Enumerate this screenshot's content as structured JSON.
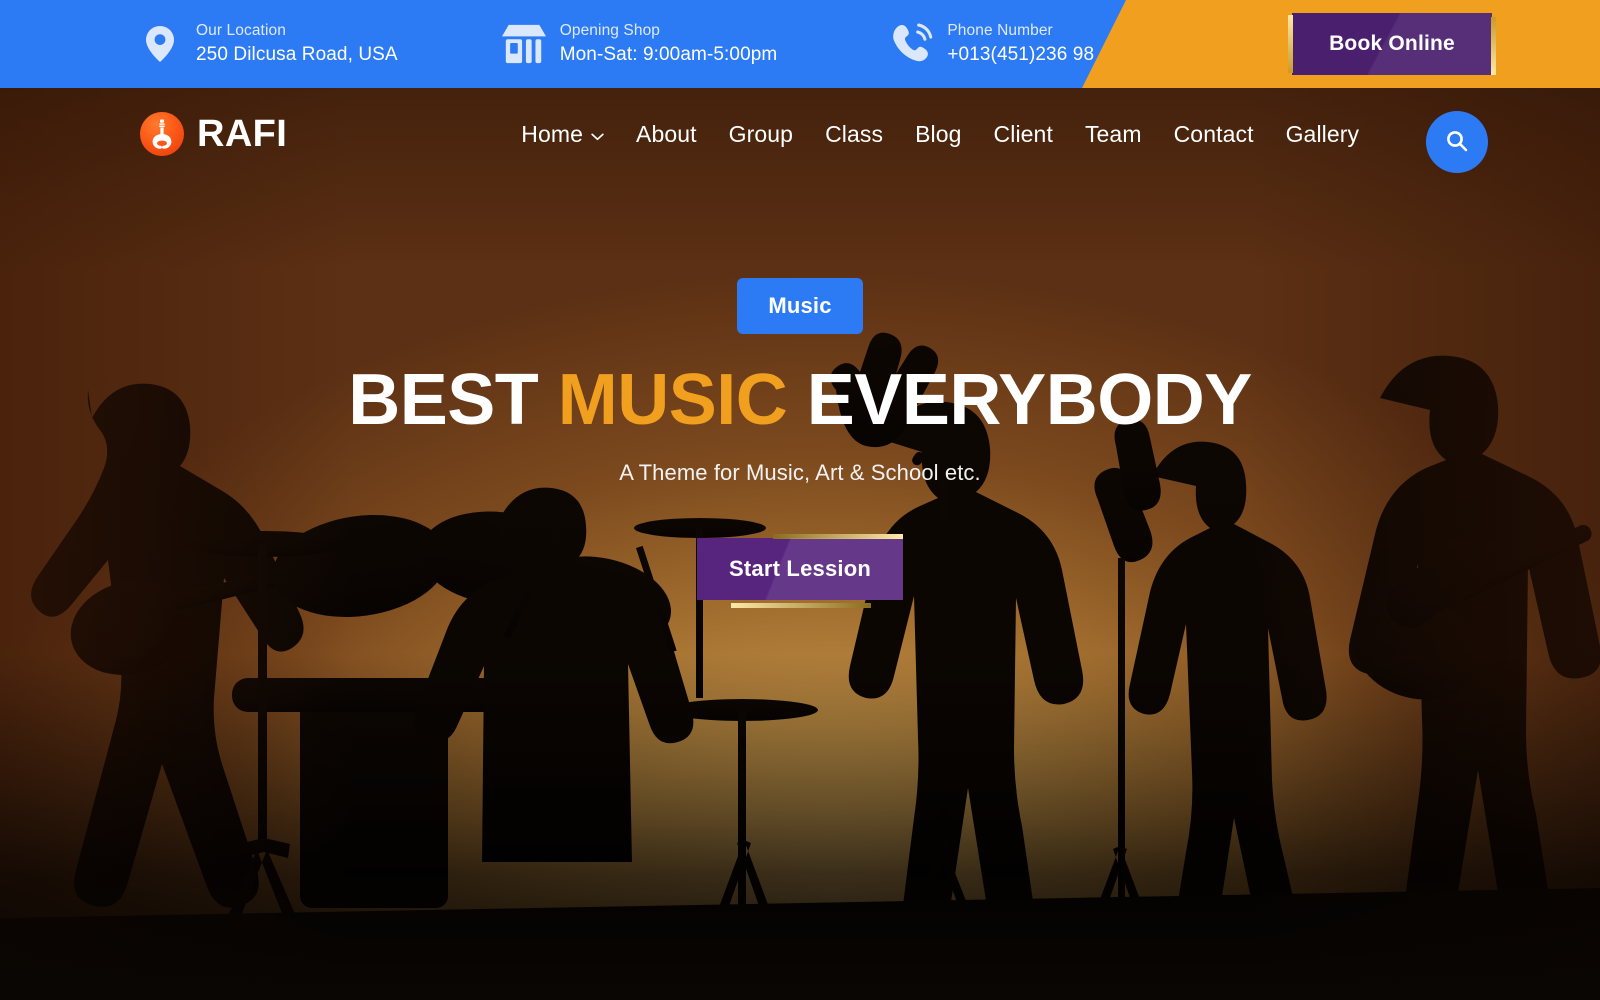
{
  "topbar": {
    "location": {
      "icon": "map-pin-icon",
      "label": "Our Location",
      "value": "250 Dilcusa Road, USA"
    },
    "opening": {
      "icon": "shop-icon",
      "label": "Opening Shop",
      "value": "Mon-Sat: 9:00am-5:00pm"
    },
    "phone": {
      "icon": "phone-ring-icon",
      "label": "Phone Number",
      "value": "+013(451)236 98"
    },
    "book_button": "Book Online",
    "blue": "#2d7bf4",
    "orange": "#f0a01e",
    "purple": "#4a1f6e"
  },
  "nav": {
    "logo_text": "RAFI",
    "logo_icon": "guitar-icon",
    "search_icon": "search-icon",
    "items": [
      {
        "label": "Home",
        "has_dropdown": true
      },
      {
        "label": "About",
        "has_dropdown": false
      },
      {
        "label": "Group",
        "has_dropdown": false
      },
      {
        "label": "Class",
        "has_dropdown": false
      },
      {
        "label": "Blog",
        "has_dropdown": false
      },
      {
        "label": "Client",
        "has_dropdown": false
      },
      {
        "label": "Team",
        "has_dropdown": false
      },
      {
        "label": "Contact",
        "has_dropdown": false
      },
      {
        "label": "Gallery",
        "has_dropdown": false
      }
    ]
  },
  "hero": {
    "badge": "Music",
    "headline_part1": "BEST ",
    "headline_highlight": "MUSIC",
    "headline_part2": " EVERYBODY",
    "subline": "A Theme for Music, Art & School etc.",
    "cta_button": "Start Lession",
    "highlight_color": "#f0a01e",
    "cta_color": "#58257e",
    "badge_color": "#2d7bf4",
    "background": "silhouette of a live band performing at sunset"
  }
}
